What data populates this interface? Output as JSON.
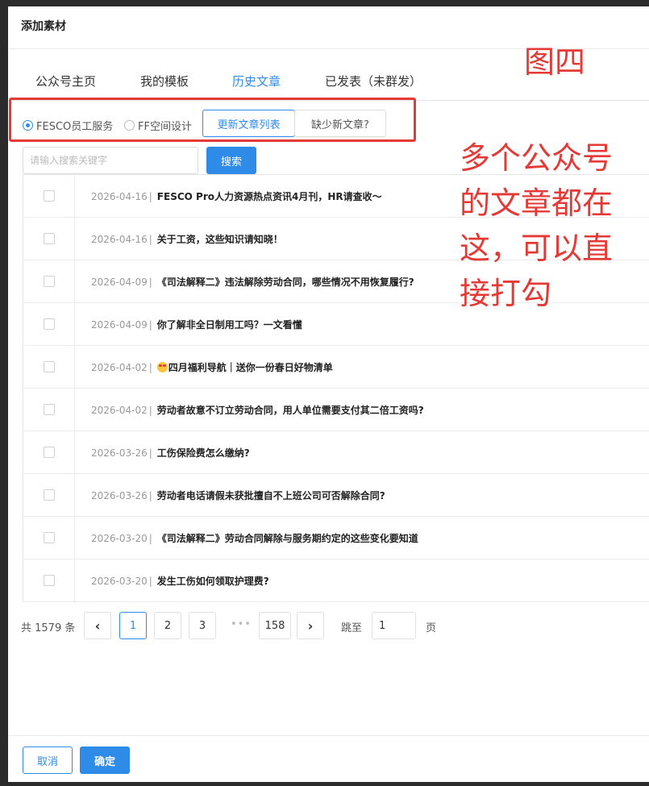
{
  "dialog": {
    "title": "添加素材"
  },
  "tabs": [
    {
      "label": "公众号主页"
    },
    {
      "label": "我的模板"
    },
    {
      "label": "历史文章"
    },
    {
      "label": "已发表（未群发）"
    }
  ],
  "filters": {
    "radios": [
      {
        "label": "FESCO员工服务",
        "selected": true
      },
      {
        "label": "FF空间设计",
        "selected": false
      }
    ],
    "refresh_label": "更新文章列表",
    "missing_label": "缺少新文章?"
  },
  "search": {
    "placeholder": "请输入搜索关键字",
    "value": "",
    "button_label": "搜索"
  },
  "rows": [
    {
      "date": "2026-04-16",
      "sep": "|",
      "title": "FESCO Pro人力资源热点资讯4月刊，HR请查收～"
    },
    {
      "date": "2026-04-16",
      "sep": "|",
      "title": "关于工资，这些知识请知晓！"
    },
    {
      "date": "2026-04-09",
      "sep": "|",
      "title": "《司法解释二》违法解除劳动合同，哪些情况不用恢复履行?"
    },
    {
      "date": "2026-04-09",
      "sep": "|",
      "title": "你了解非全日制用工吗？一文看懂"
    },
    {
      "date": "2026-04-02",
      "sep": "|",
      "title": "四月福利导航｜送你一份春日好物清单"
    },
    {
      "date": "2026-04-02",
      "sep": "|",
      "title": "劳动者故意不订立劳动合同，用人单位需要支付其二倍工资吗?"
    },
    {
      "date": "2026-03-26",
      "sep": "|",
      "title": "工伤保险费怎么缴纳?"
    },
    {
      "date": "2026-03-26",
      "sep": "|",
      "title": "劳动者电话请假未获批擅自不上班公司可否解除合同?"
    },
    {
      "date": "2026-03-20",
      "sep": "|",
      "title": "《司法解释二》劳动合同解除与服务期约定的这些变化要知道"
    },
    {
      "date": "2026-03-20",
      "sep": "|",
      "title": "发生工伤如何领取护理费?"
    }
  ],
  "pagination": {
    "total_text": "共 1579 条",
    "prev": "‹",
    "next": "›",
    "pages": [
      "1",
      "2",
      "3",
      "158"
    ],
    "current": "1",
    "ellipsis": "•••",
    "jump_label": "跳至",
    "jump_value": "1",
    "page_label": "页"
  },
  "footer": {
    "cancel_label": "取消",
    "ok_label": "确定"
  },
  "annotations": {
    "figure_label": "图四",
    "note": "多个公众号的文章都在这，可以直接打勾"
  },
  "colors": {
    "accent": "#2f8be8",
    "annotation": "#e53935"
  }
}
